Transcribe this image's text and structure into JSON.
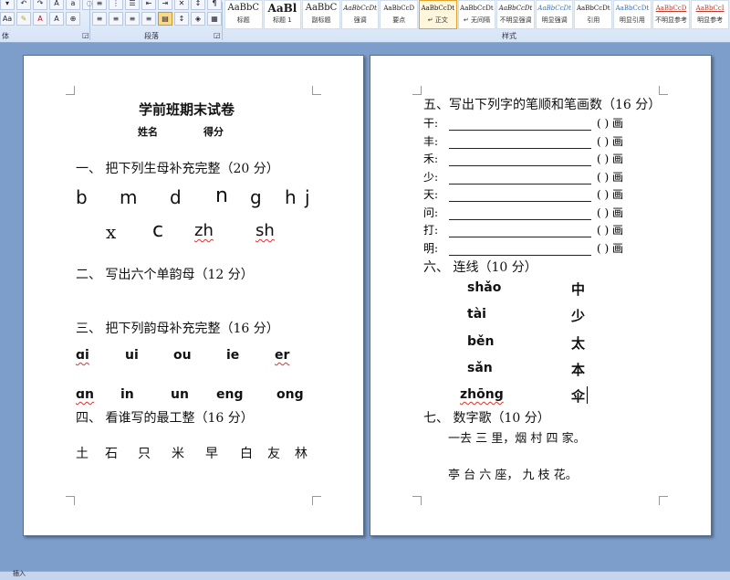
{
  "ribbon": {
    "group_font": "体",
    "group_paragraph": "段落",
    "group_styles": "样式",
    "font_row2": [
      "Aa",
      "A",
      "A"
    ],
    "styles": [
      {
        "preview": "AaBbC",
        "name": "标题"
      },
      {
        "preview": "AaBl",
        "name": "标题 1"
      },
      {
        "preview": "AaBbC",
        "name": "副标题"
      },
      {
        "preview": "AaBbCcDt",
        "name": "强调"
      },
      {
        "preview": "AaBbCcD",
        "name": "要点"
      },
      {
        "preview": "AaBbCcDt",
        "name": "↵ 正文"
      },
      {
        "preview": "AaBbCcDt",
        "name": "↵ 无间隔"
      },
      {
        "preview": "AaBbCcDt",
        "name": "不明显强调"
      },
      {
        "preview": "AaBbCcDt",
        "name": "明显强调"
      },
      {
        "preview": "AaBbCcDt",
        "name": "引用"
      },
      {
        "preview": "AaBbCcDt",
        "name": "明显引用"
      },
      {
        "preview": "AaBbCcD",
        "name": "不明显参考"
      },
      {
        "preview": "AaBbCcI",
        "name": "明显参考"
      }
    ]
  },
  "left": {
    "title": "学前班期末试卷",
    "name_label": "姓名",
    "score_label": "得分",
    "s1": "一、  把下列生母补充完整（20 分）",
    "s1_row1": [
      "b",
      "m",
      "d",
      "n",
      "g",
      "h",
      "j"
    ],
    "s1_row2": [
      "x",
      "c",
      "zh",
      "sh"
    ],
    "s2": "二、  写出六个单韵母（12 分）",
    "s3": "三、  把下列韵母补充完整（16 分）",
    "s3_row1": [
      "ɑi",
      "ui",
      "ou",
      "ie",
      "er"
    ],
    "s3_row2": [
      "ɑn",
      "in",
      "un",
      "eng",
      "ong"
    ],
    "s4": "四、  看谁写的最工整（16 分）",
    "s4_chars": [
      "土",
      "石",
      "只",
      "米",
      "早",
      "白",
      "友",
      "林"
    ]
  },
  "right": {
    "s5": "五、写出下列字的笔顺和笔画数（16 分）",
    "strokes": [
      {
        "char": "干:",
        "suffix": "(     ) 画"
      },
      {
        "char": "丰:",
        "suffix": "(     ) 画"
      },
      {
        "char": "禾:",
        "suffix": "(     ) 画"
      },
      {
        "char": "少:",
        "suffix": "(     ) 画"
      },
      {
        "char": "天:",
        "suffix": "(     ) 画"
      },
      {
        "char": "问:",
        "suffix": "(     ) 画"
      },
      {
        "char": "打:",
        "suffix": "(     ) 画"
      },
      {
        "char": "明:",
        "suffix": "(     ) 画"
      }
    ],
    "s6": "六、  连线（10 分）",
    "match_pinyin": [
      "shǎo",
      "tài",
      "běn",
      "sǎn",
      "zhōng"
    ],
    "match_hanzi": [
      "中",
      "少",
      "太",
      "本",
      "伞"
    ],
    "s7": "七、  数字歌（10 分）",
    "poem1": "一去   三 里，烟 村 四   家。",
    "poem2": "亭 台 六   座，   九   枝 花。"
  },
  "statusbar": {
    "left": "插入"
  }
}
